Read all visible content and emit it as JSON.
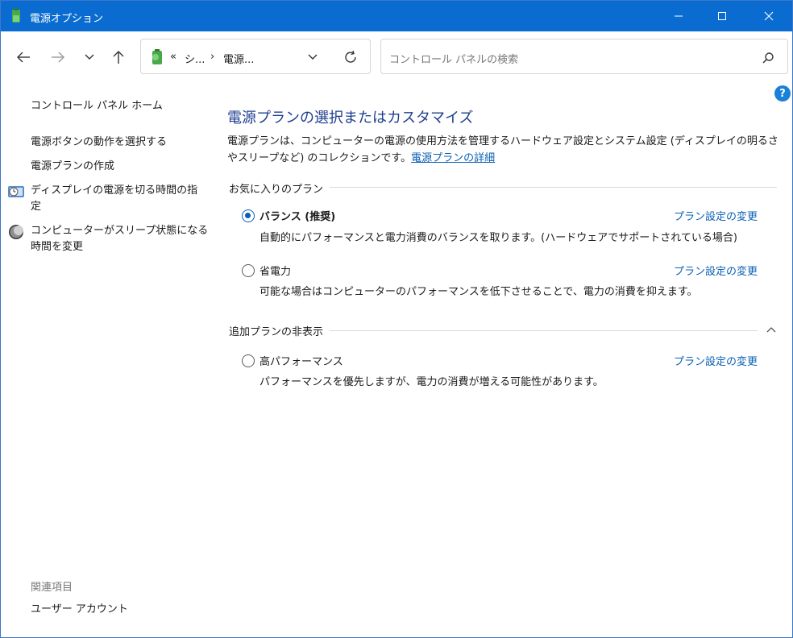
{
  "window": {
    "title": "電源オプション"
  },
  "nav": {
    "address_prefix": "«",
    "address_seg1": "シ...",
    "address_sep": "›",
    "address_seg2": "電源..."
  },
  "search": {
    "placeholder": "コントロール パネルの検索"
  },
  "help": {
    "label": "?"
  },
  "sidebar": {
    "home": "コントロール パネル ホーム",
    "links": [
      "電源ボタンの動作を選択する",
      "電源プランの作成",
      "ディスプレイの電源を切る時間の指定",
      "コンピューターがスリープ状態になる時間を変更"
    ],
    "display_link_line1": "ディスプレイの電源を切る時間の指",
    "display_link_line2": "定",
    "sleep_link_line1": "コンピューターがスリープ状態になる",
    "sleep_link_line2": "時間を変更",
    "related_heading": "関連項目",
    "related_link": "ユーザー アカウント"
  },
  "main": {
    "heading": "電源プランの選択またはカスタマイズ",
    "description": "電源プランは、コンピューターの電源の使用方法を管理するハードウェア設定とシステム設定 (ディスプレイの明るさやスリープなど) のコレクションです。",
    "description_link": "電源プランの詳細",
    "favorites_title": "お気に入りのプラン",
    "hidden_title": "追加プランの非表示",
    "plans": [
      {
        "name": "バランス (推奨)",
        "description": "自動的にパフォーマンスと電力消費のバランスを取ります。(ハードウェアでサポートされている場合)",
        "link": "プラン設定の変更",
        "selected": true
      },
      {
        "name": "省電力",
        "description": "可能な場合はコンピューターのパフォーマンスを低下させることで、電力の消費を抑えます。",
        "link": "プラン設定の変更",
        "selected": false
      }
    ],
    "hidden_plans": [
      {
        "name": "高パフォーマンス",
        "description": "パフォーマンスを優先しますが、電力の消費が増える可能性があります。",
        "link": "プラン設定の変更",
        "selected": false
      }
    ]
  },
  "colors": {
    "titlebar": "#0a6cd1",
    "link": "#0a5fb4",
    "heading": "#1e3f8f"
  }
}
